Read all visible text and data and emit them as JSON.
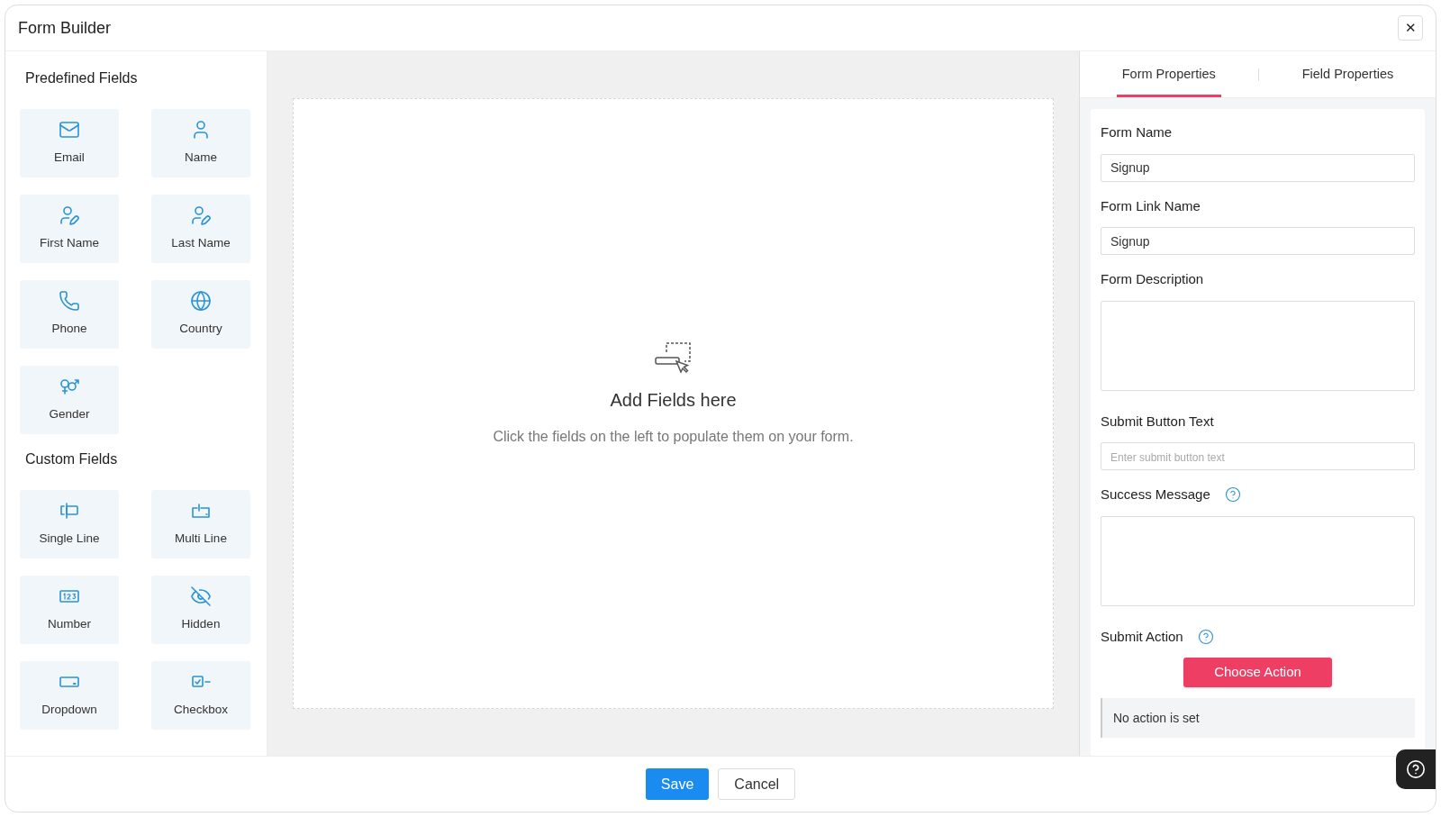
{
  "window": {
    "title": "Form Builder",
    "close": "✕"
  },
  "sidebar": {
    "sections": [
      {
        "title": "Predefined Fields",
        "items": [
          {
            "label": "Email"
          },
          {
            "label": "Name"
          },
          {
            "label": "First Name"
          },
          {
            "label": "Last Name"
          },
          {
            "label": "Phone"
          },
          {
            "label": "Country"
          },
          {
            "label": "Gender"
          }
        ]
      },
      {
        "title": "Custom Fields",
        "items": [
          {
            "label": "Single Line"
          },
          {
            "label": "Multi Line"
          },
          {
            "label": "Number"
          },
          {
            "label": "Hidden"
          },
          {
            "label": "Dropdown"
          },
          {
            "label": "Checkbox"
          }
        ]
      }
    ]
  },
  "canvas": {
    "title": "Add Fields here",
    "hint": "Click the fields on the left to populate them on your form."
  },
  "tabs": [
    {
      "label": "Form Properties",
      "selected": true
    },
    {
      "label": "Field Properties",
      "selected": false
    }
  ],
  "properties": [
    {
      "kind": "input",
      "label": "Form Name",
      "value": "Signup",
      "help": false
    },
    {
      "kind": "input",
      "label": "Form Link Name",
      "value": "Signup",
      "help": false
    },
    {
      "kind": "textarea",
      "label": "Form Description",
      "help": false
    },
    {
      "kind": "input",
      "label": "Submit Button Text",
      "placeholder": "Enter submit button text",
      "help": false
    },
    {
      "kind": "textarea",
      "label": "Success Message",
      "help": true
    },
    {
      "kind": "action",
      "label": "Submit Action",
      "help": true,
      "button": "Choose Action",
      "status": "No action is set"
    }
  ],
  "footer": {
    "buttons": [
      {
        "label": "Save",
        "kind": "primary"
      },
      {
        "label": "Cancel",
        "kind": "secondary"
      }
    ]
  }
}
